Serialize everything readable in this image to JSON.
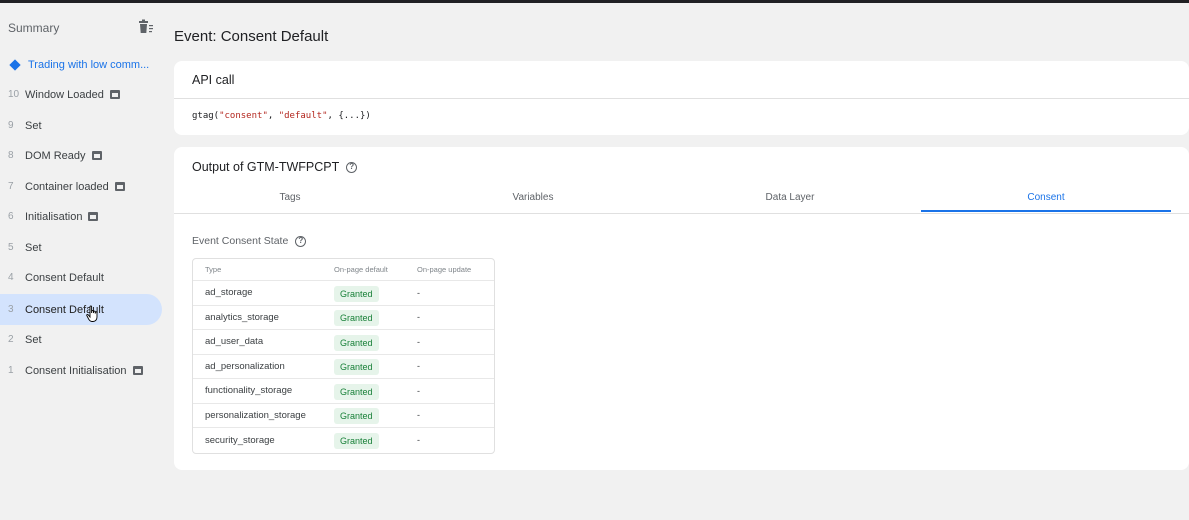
{
  "sidebar": {
    "title": "Summary",
    "current": "Trading with low comm...",
    "items": [
      {
        "num": "10",
        "label": "Window Loaded",
        "icon": true
      },
      {
        "num": "9",
        "label": "Set",
        "icon": false
      },
      {
        "num": "8",
        "label": "DOM Ready",
        "icon": true
      },
      {
        "num": "7",
        "label": "Container loaded",
        "icon": true
      },
      {
        "num": "6",
        "label": "Initialisation",
        "icon": true
      },
      {
        "num": "5",
        "label": "Set",
        "icon": false
      },
      {
        "num": "4",
        "label": "Consent Default",
        "icon": false
      },
      {
        "num": "3",
        "label": "Consent Default",
        "icon": false
      },
      {
        "num": "2",
        "label": "Set",
        "icon": false
      },
      {
        "num": "1",
        "label": "Consent Initialisation",
        "icon": true
      }
    ]
  },
  "main": {
    "event_title": "Event: Consent Default",
    "api_call": {
      "heading": "API call",
      "fn": "gtag(",
      "arg1": "\"consent\"",
      "sep": ", ",
      "arg2": "\"default\"",
      "rest": ", {...})"
    },
    "output": {
      "heading": "Output of GTM-TWFPCPT",
      "tabs": [
        "Tags",
        "Variables",
        "Data Layer",
        "Consent"
      ],
      "active_tab": "Consent",
      "consent_state_title": "Event Consent State",
      "table_headers": [
        "Type",
        "On-page default",
        "On-page update"
      ],
      "rows": [
        {
          "type": "ad_storage",
          "default": "Granted",
          "update": "-"
        },
        {
          "type": "analytics_storage",
          "default": "Granted",
          "update": "-"
        },
        {
          "type": "ad_user_data",
          "default": "Granted",
          "update": "-"
        },
        {
          "type": "ad_personalization",
          "default": "Granted",
          "update": "-"
        },
        {
          "type": "functionality_storage",
          "default": "Granted",
          "update": "-"
        },
        {
          "type": "personalization_storage",
          "default": "Granted",
          "update": "-"
        },
        {
          "type": "security_storage",
          "default": "Granted",
          "update": "-"
        }
      ]
    }
  },
  "colors": {
    "accent": "#1a73e8",
    "granted_bg": "#e6f4ea",
    "granted_text": "#188038",
    "selected_bg": "#d3e3fd"
  }
}
